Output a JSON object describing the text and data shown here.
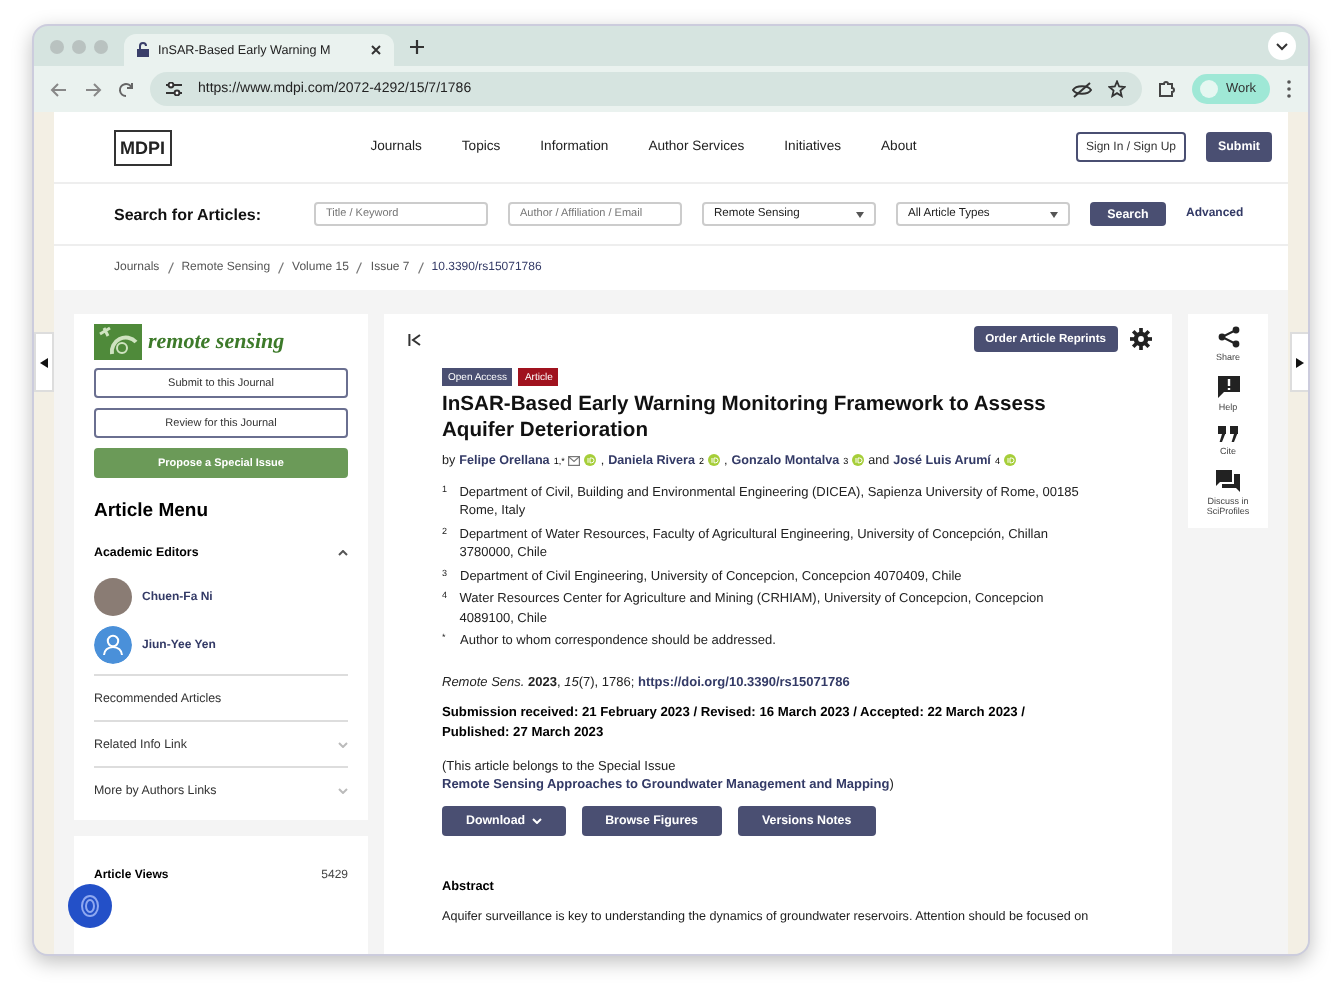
{
  "browser": {
    "tab_title": "InSAR-Based Early Warning M",
    "url": "https://www.mdpi.com/2072-4292/15/7/1786",
    "profile": "Work"
  },
  "header": {
    "logo": "MDPI",
    "nav": [
      "Journals",
      "Topics",
      "Information",
      "Author Services",
      "Initiatives",
      "About"
    ],
    "sign_in": "Sign In / Sign Up",
    "submit": "Submit"
  },
  "search": {
    "label": "Search for Articles:",
    "fields": [
      {
        "placeholder": "Title / Keyword"
      },
      {
        "placeholder": "Author / Affiliation / Email"
      }
    ],
    "selects": [
      "Remote Sensing",
      "All Article Types"
    ],
    "button": "Search",
    "advanced": "Advanced"
  },
  "breadcrumb": [
    "Journals",
    "Remote Sensing",
    "Volume 15",
    "Issue 7",
    "10.3390/rs15071786"
  ],
  "sidebar": {
    "journal": "remote sensing",
    "buttons": [
      {
        "label": "Submit to this Journal",
        "kind": "outline"
      },
      {
        "label": "Review for this Journal",
        "kind": "outline"
      },
      {
        "label": "Propose a Special Issue",
        "kind": "primary"
      }
    ],
    "menu_title": "Article Menu",
    "editors_section": {
      "label": "Academic Editors",
      "expanded": true
    },
    "editors": [
      {
        "name": "Chuen-Fa Ni",
        "kind": "photo"
      },
      {
        "name": "Jiun-Yee Yen",
        "kind": "generic"
      }
    ],
    "links": [
      {
        "label": "Recommended Articles",
        "expandable": false
      },
      {
        "label": "Related Info Link",
        "expandable": true
      },
      {
        "label": "More by Authors Links",
        "expandable": true
      }
    ],
    "views": {
      "label": "Article Views",
      "value": "5429"
    }
  },
  "article": {
    "order_button": "Order Article Reprints",
    "badges": [
      {
        "label": "Open Access",
        "color": "#4a4f72"
      },
      {
        "label": "Article",
        "color": "#a0121e"
      }
    ],
    "title": "InSAR-Based Early Warning Monitoring Framework to Assess Aquifer Deterioration",
    "authors": [
      {
        "prefix": "by",
        "name": "Felipe Orellana",
        "sup": "1,*",
        "email": true
      },
      {
        "prefix": ",",
        "name": "Daniela Rivera",
        "sup": "2",
        "email": false
      },
      {
        "prefix": ",",
        "name": "Gonzalo Montalva",
        "sup": "3",
        "email": false
      },
      {
        "prefix": "and",
        "name": "José Luis Arumí",
        "sup": "4",
        "email": false
      }
    ],
    "affiliations": [
      {
        "mark": "1",
        "text": "Department of Civil, Building and Environmental Engineering (DICEA), Sapienza University of Rome, 00185 Rome, Italy"
      },
      {
        "mark": "2",
        "text": "Department of Water Resources, Faculty of Agricultural Engineering, University of Concepción, Chillan 3780000, Chile"
      },
      {
        "mark": "3",
        "text": "Department of Civil Engineering, University of Concepcion, Concepcion 4070409, Chile"
      },
      {
        "mark": "4",
        "text": "Water Resources Center for Agriculture and Mining (CRHIAM), University of Concepcion, Concepcion 4089100, Chile"
      },
      {
        "mark": "*",
        "text": "Author to whom correspondence should be addressed."
      }
    ],
    "citation": "*Remote Sens.* **2023**, *15*(7), 1786;",
    "doi": "https://doi.org/10.3390/rs15071786",
    "dates": "Submission received: 21 February 2023 / Revised: 16 March 2023 / Accepted: 22 March 2023 / Published: 27 March 2023",
    "special_issue_prefix": "(This article belongs to the Special Issue",
    "special_issue": "Remote Sensing Approaches to Groundwater Management and Mapping",
    "special_issue_suffix": ")",
    "actions": [
      {
        "label": "Download",
        "kind": "dropdown"
      },
      {
        "label": "Browse Figures",
        "kind": "plain"
      },
      {
        "label": "Versions Notes",
        "kind": "plain"
      }
    ],
    "abstract_heading": "Abstract",
    "abstract": "Aquifer surveillance is key to understanding the dynamics of groundwater reservoirs. Attention should be focused on"
  },
  "tools": [
    {
      "label": "Share",
      "kind": "share"
    },
    {
      "label": "Help",
      "kind": "help"
    },
    {
      "label": "Cite",
      "kind": "cite"
    },
    {
      "label": "Discuss in SciProfiles",
      "kind": "discuss"
    }
  ]
}
